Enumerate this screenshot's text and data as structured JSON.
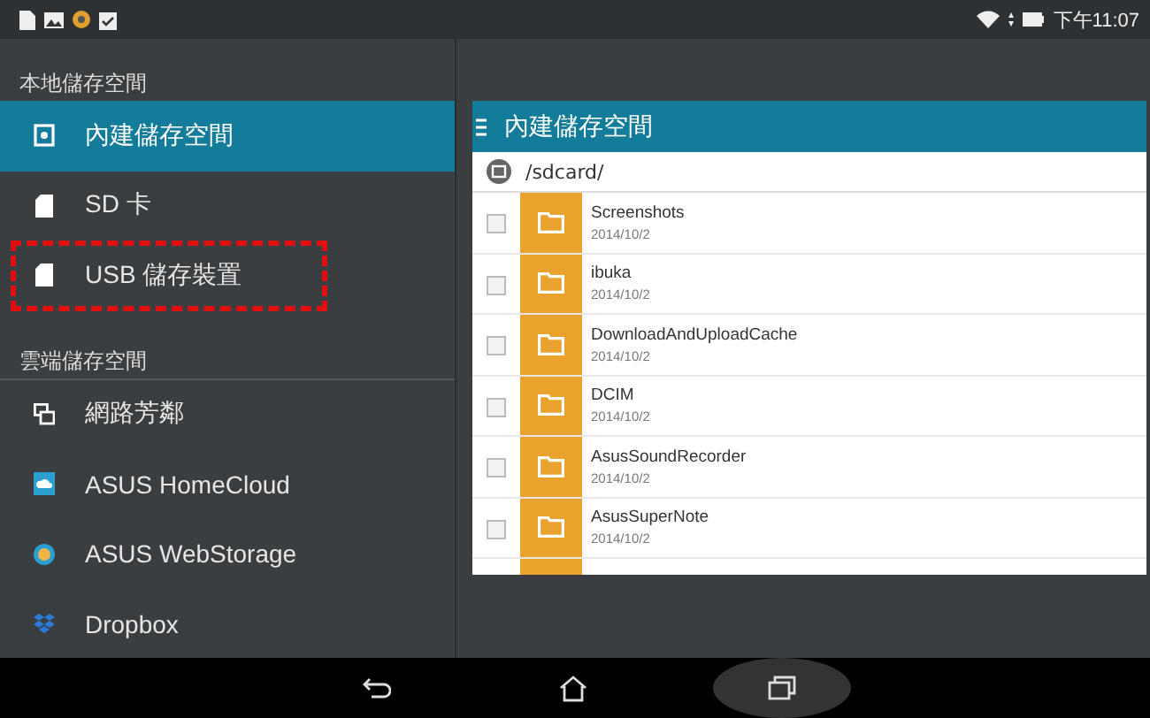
{
  "status_bar": {
    "time": "下午11:07"
  },
  "sidebar": {
    "sections": [
      {
        "title": "本地儲存空間",
        "items": [
          {
            "label": "內建儲存空間",
            "kind": "internal",
            "selected": true,
            "highlighted": false
          },
          {
            "label": "SD 卡",
            "kind": "card",
            "selected": false,
            "highlighted": false
          },
          {
            "label": "USB 儲存裝置",
            "kind": "card",
            "selected": false,
            "highlighted": true
          }
        ]
      },
      {
        "title": "雲端儲存空間",
        "items": [
          {
            "label": "網路芳鄰",
            "kind": "network",
            "selected": false,
            "highlighted": false
          },
          {
            "label": "ASUS HomeCloud",
            "kind": "homecloud",
            "selected": false,
            "highlighted": false
          },
          {
            "label": "ASUS WebStorage",
            "kind": "webstorage",
            "selected": false,
            "highlighted": false
          },
          {
            "label": "Dropbox",
            "kind": "dropbox",
            "selected": false,
            "highlighted": false
          }
        ]
      }
    ]
  },
  "content": {
    "title": "內建儲存空間",
    "path": "/sdcard/",
    "files": [
      {
        "name": "Screenshots",
        "date": "2014/10/2",
        "checked": false
      },
      {
        "name": "ibuka",
        "date": "2014/10/2",
        "checked": false
      },
      {
        "name": "DownloadAndUploadCache",
        "date": "2014/10/2",
        "checked": false
      },
      {
        "name": "DCIM",
        "date": "2014/10/2",
        "checked": false
      },
      {
        "name": "AsusSoundRecorder",
        "date": "2014/10/2",
        "checked": false
      },
      {
        "name": "AsusSuperNote",
        "date": "2014/10/2",
        "checked": false
      }
    ]
  }
}
